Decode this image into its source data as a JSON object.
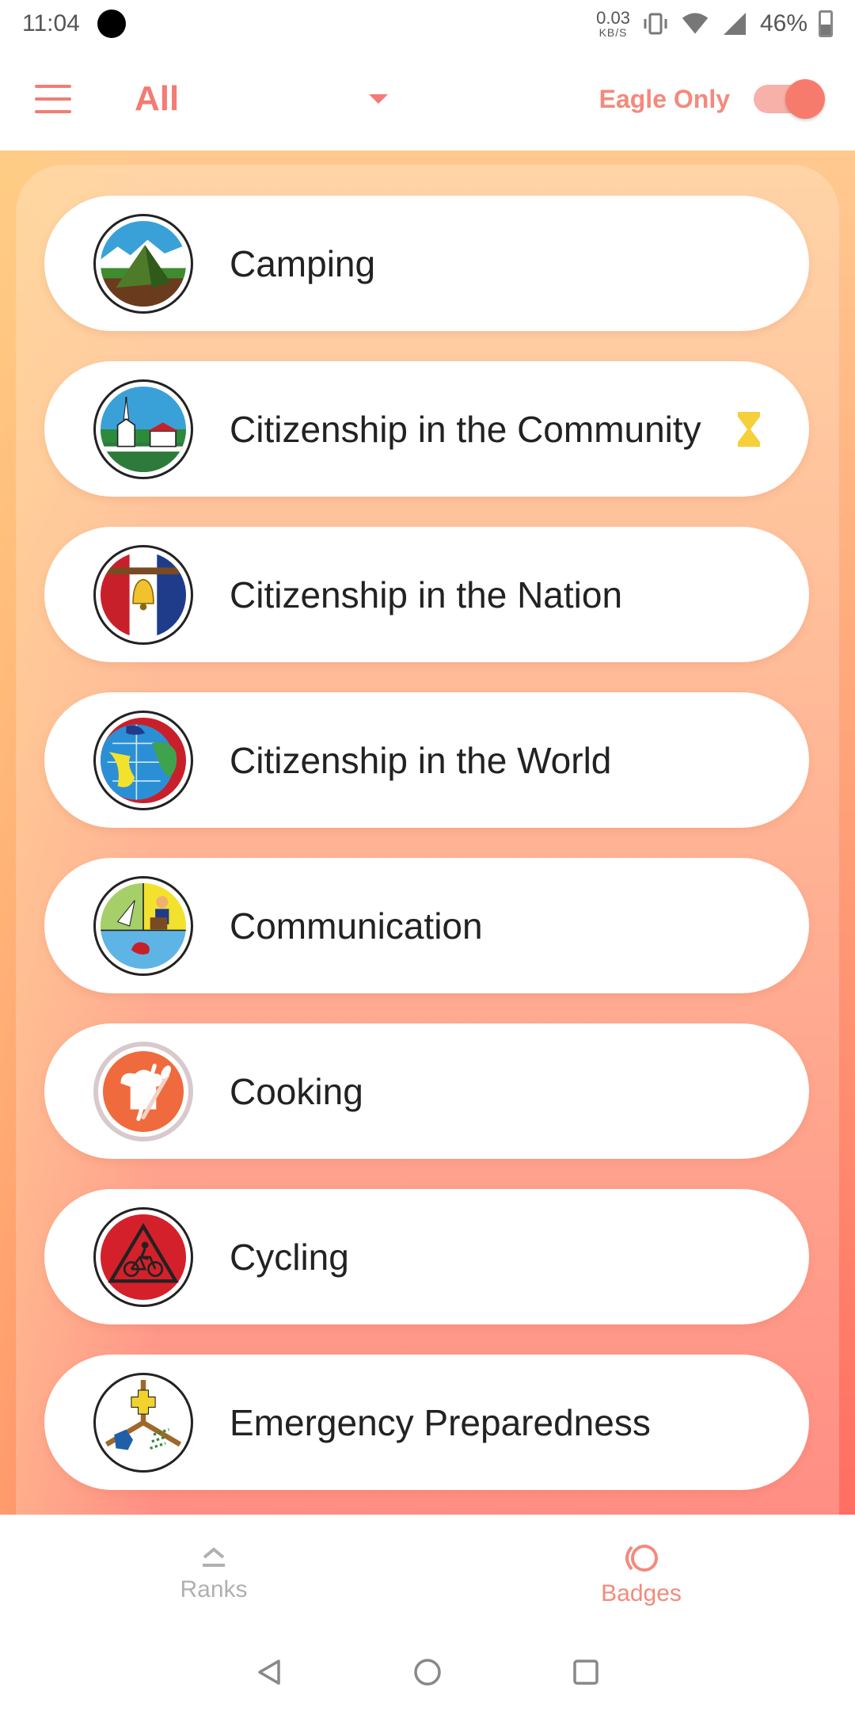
{
  "status_bar": {
    "time": "11:04",
    "net_speed_value": "0.03",
    "net_speed_unit": "KB/S",
    "battery": "46%"
  },
  "app_bar": {
    "filter_value": "All",
    "eagle_label": "Eagle Only",
    "eagle_toggle_on": true
  },
  "badges": [
    {
      "name": "Camping",
      "icon": "camping-icon",
      "in_progress": false
    },
    {
      "name": "Citizenship in the Community",
      "icon": "citizenship-community-icon",
      "in_progress": true
    },
    {
      "name": "Citizenship in the Nation",
      "icon": "citizenship-nation-icon",
      "in_progress": false
    },
    {
      "name": "Citizenship in the World",
      "icon": "citizenship-world-icon",
      "in_progress": false
    },
    {
      "name": "Communication",
      "icon": "communication-icon",
      "in_progress": false
    },
    {
      "name": "Cooking",
      "icon": "cooking-icon",
      "in_progress": false
    },
    {
      "name": "Cycling",
      "icon": "cycling-icon",
      "in_progress": false
    },
    {
      "name": "Emergency Preparedness",
      "icon": "emergency-preparedness-icon",
      "in_progress": false
    }
  ],
  "bottom_nav": {
    "ranks_label": "Ranks",
    "badges_label": "Badges",
    "active": "Badges"
  },
  "colors": {
    "accent": "#f27c74",
    "hourglass": "#f5d03b",
    "gradient_top": "#ffc98f",
    "gradient_bottom": "#ff6e62"
  }
}
